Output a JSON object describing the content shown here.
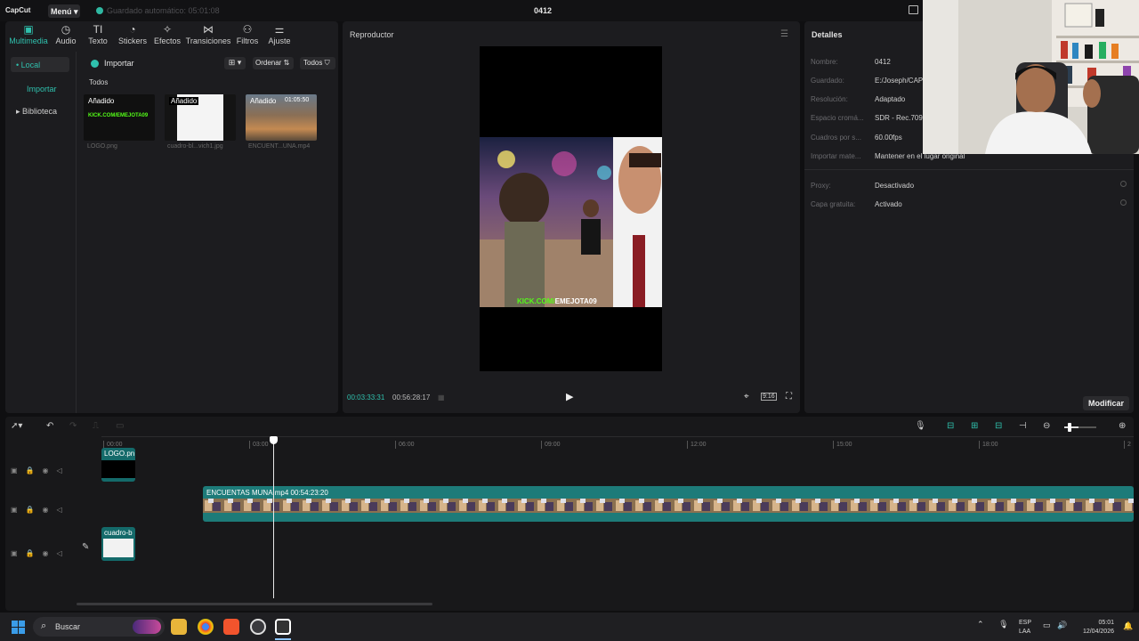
{
  "app": {
    "logo": "CapCut",
    "menu_label": "Menú",
    "autosave": "Guardado automático: 05:01:08",
    "project_title": "0412"
  },
  "media": {
    "tabs": [
      {
        "label": "Multimedia",
        "icon": "media-icon",
        "active": true
      },
      {
        "label": "Audio",
        "icon": "audio-icon"
      },
      {
        "label": "Texto",
        "icon": "text-icon"
      },
      {
        "label": "Stickers",
        "icon": "sticker-icon"
      },
      {
        "label": "Efectos",
        "icon": "effects-icon"
      },
      {
        "label": "Transiciones",
        "icon": "transitions-icon"
      },
      {
        "label": "Filtros",
        "icon": "filters-icon"
      },
      {
        "label": "Ajuste",
        "icon": "adjust-icon"
      }
    ],
    "sidebar": {
      "local": "• Local",
      "import": "Importar",
      "library": "▸ Biblioteca"
    },
    "import_label": "Importar",
    "sort_label": "Ordenar",
    "filter_label": "Todos",
    "section_label": "Todos",
    "thumbs": [
      {
        "tag": "Añadido",
        "name": "LOGO.png",
        "overlay": "KICK.COM/EMEJOTA09"
      },
      {
        "tag": "Añadido",
        "name": "cuadro-bl...vich1.jpg"
      },
      {
        "tag": "Añadido",
        "name": "ENCUENT...UNA.mp4",
        "duration": "01:05:50"
      }
    ]
  },
  "player": {
    "title": "Reproductor",
    "overlay_text_green": "KICK.COM/",
    "overlay_text_white": "EMEJOTA09",
    "time_current": "00:03:33:31",
    "time_total": "00:56:28:17",
    "ratio": "9:16"
  },
  "details": {
    "title": "Detalles",
    "rows": [
      {
        "label": "Nombre:",
        "value": "0412"
      },
      {
        "label": "Guardado:",
        "value": "E:/Joseph/CAP"
      },
      {
        "label": "Resolución:",
        "value": "Adaptado"
      },
      {
        "label": "Espacio cromá...",
        "value": "SDR - Rec.709"
      },
      {
        "label": "Cuadros por s...",
        "value": "60.00fps"
      },
      {
        "label": "Importar mate...",
        "value": "Mantener en el lugar original"
      }
    ],
    "rows2": [
      {
        "label": "Proxy:",
        "value": "Desactivado"
      },
      {
        "label": "Capa gratuita:",
        "value": "Activado"
      }
    ],
    "modify_label": "Modificar"
  },
  "timeline": {
    "ticks": [
      "00:00",
      "03:00",
      "06:00",
      "09:00",
      "12:00",
      "15:00",
      "18:00",
      "2"
    ],
    "clips": {
      "logo": "LOGO.pn",
      "main": "ENCUENTAS MUNA.mp4  00:54:23:20",
      "cuadro": "cuadro-b"
    }
  },
  "taskbar": {
    "search_placeholder": "Buscar",
    "lang_line1": "ESP",
    "lang_line2": "LAA",
    "time": "05:01",
    "date": "12/04/2026"
  },
  "colors": {
    "accent": "#2fc0ad",
    "panel": "#1c1c1f",
    "background": "#0f0f11",
    "clip": "#1d7b79"
  }
}
